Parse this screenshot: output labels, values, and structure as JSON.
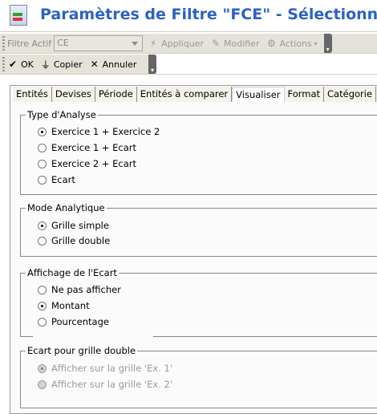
{
  "header": {
    "title": "Paramètres de Filtre \"FCE\" - Sélectionner"
  },
  "toolbar1": {
    "filter_label": "Filtre Actif",
    "filter_value": "CE",
    "apply": "Appliquer",
    "modify": "Modifier",
    "actions": "Actions"
  },
  "toolbar2": {
    "ok": "OK",
    "copy": "Copier",
    "cancel": "Annuler"
  },
  "tabs": [
    {
      "label": "Entités"
    },
    {
      "label": "Devises"
    },
    {
      "label": "Période"
    },
    {
      "label": "Entités à comparer"
    },
    {
      "label": "Visualiser",
      "active": true
    },
    {
      "label": "Format"
    },
    {
      "label": "Catégorie"
    }
  ],
  "groups": {
    "analysis": {
      "title": "Type d'Analyse",
      "options": [
        "Exercice 1 + Exercice 2",
        "Exercice 1 + Ecart",
        "Exercice 2 + Ecart",
        "Ecart"
      ],
      "selected": 0
    },
    "mode": {
      "title": "Mode Analytique",
      "options": [
        "Grille simple",
        "Grille double"
      ],
      "selected": 0
    },
    "display": {
      "title": "Affichage de l'Ecart",
      "options": [
        "Ne pas afficher",
        "Montant",
        "Pourcentage"
      ],
      "selected": 1
    },
    "double": {
      "title": "Ecart pour grille double",
      "options": [
        "Afficher sur la grille 'Ex. 1'",
        "Afficher sur la grille 'Ex. 2'"
      ],
      "selected": 0,
      "disabled": true
    }
  }
}
